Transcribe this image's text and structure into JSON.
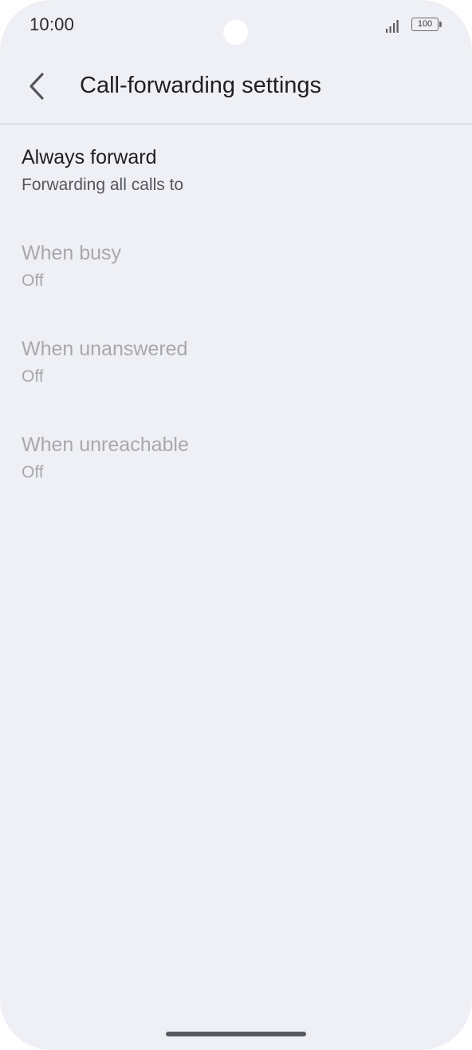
{
  "status_bar": {
    "time": "10:00",
    "battery_level": "100",
    "icons": [
      "signal-icon",
      "battery-icon"
    ]
  },
  "header": {
    "back_icon": "chevron-left-icon",
    "title": "Call-forwarding settings"
  },
  "settings": [
    {
      "label": "Always forward",
      "subtitle": "Forwarding all calls to",
      "enabled": true
    },
    {
      "label": "When busy",
      "subtitle": "Off",
      "enabled": false
    },
    {
      "label": "When unanswered",
      "subtitle": "Off",
      "enabled": false
    },
    {
      "label": "When unreachable",
      "subtitle": "Off",
      "enabled": false
    }
  ],
  "colors": {
    "background": "#eff0f5",
    "text_primary": "#1f1f22",
    "text_secondary": "#55565c",
    "text_disabled": "#a7a8ad"
  }
}
